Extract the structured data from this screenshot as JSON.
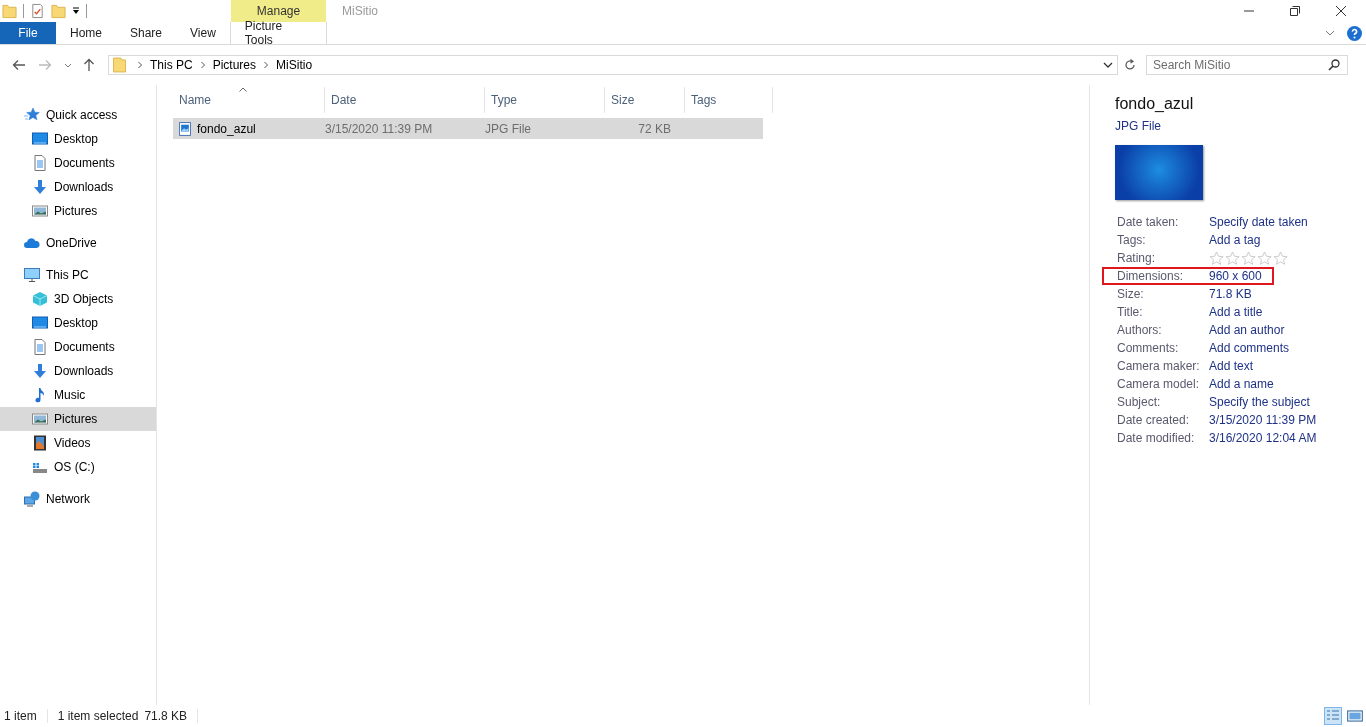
{
  "window": {
    "title": "MiSitio",
    "context_tab_group": "Manage"
  },
  "ribbon_tabs": [
    {
      "label": "File",
      "kind": "file",
      "selected": false
    },
    {
      "label": "Home",
      "kind": "tab",
      "selected": false
    },
    {
      "label": "Share",
      "kind": "tab",
      "selected": false
    },
    {
      "label": "View",
      "kind": "tab",
      "selected": false
    },
    {
      "label": "Picture Tools",
      "kind": "context",
      "selected": false
    }
  ],
  "breadcrumb": [
    "This PC",
    "Pictures",
    "MiSitio"
  ],
  "search": {
    "placeholder": "Search MiSitio"
  },
  "sidebar": {
    "items": [
      {
        "label": "Quick access",
        "kind": "star",
        "selected": false,
        "children": [
          {
            "label": "Desktop",
            "kind": "desktop",
            "selected": false
          },
          {
            "label": "Documents",
            "kind": "document",
            "selected": false
          },
          {
            "label": "Downloads",
            "kind": "download",
            "selected": false
          },
          {
            "label": "Pictures",
            "kind": "picture",
            "selected": false
          }
        ]
      },
      {
        "label": "OneDrive",
        "kind": "cloud",
        "selected": false
      },
      {
        "label": "This PC",
        "kind": "pc",
        "selected": false,
        "children": [
          {
            "label": "3D Objects",
            "kind": "cube",
            "selected": false
          },
          {
            "label": "Desktop",
            "kind": "desktop",
            "selected": false
          },
          {
            "label": "Documents",
            "kind": "document",
            "selected": false
          },
          {
            "label": "Downloads",
            "kind": "download",
            "selected": false
          },
          {
            "label": "Music",
            "kind": "music",
            "selected": false
          },
          {
            "label": "Pictures",
            "kind": "picture",
            "selected": true
          },
          {
            "label": "Videos",
            "kind": "video",
            "selected": false
          },
          {
            "label": "OS (C:)",
            "kind": "drive",
            "selected": false
          }
        ]
      },
      {
        "label": "Network",
        "kind": "network",
        "selected": false
      }
    ]
  },
  "table": {
    "columns": [
      "Name",
      "Date",
      "Type",
      "Size",
      "Tags"
    ],
    "rows": [
      {
        "name": "fondo_azul",
        "date": "3/15/2020 11:39 PM",
        "type": "JPG File",
        "size": "72 KB",
        "selected": true
      }
    ]
  },
  "details": {
    "name": "fondo_azul",
    "type": "JPG File",
    "properties": [
      {
        "label": "Date taken:",
        "value": "Specify date taken",
        "kind": "text",
        "highlighted": false
      },
      {
        "label": "Tags:",
        "value": "Add a tag",
        "kind": "text",
        "highlighted": false
      },
      {
        "label": "Rating:",
        "kind": "rating",
        "stars": 0,
        "highlighted": false
      },
      {
        "label": "Dimensions:",
        "value": "960 x 600",
        "kind": "text",
        "highlighted": true
      },
      {
        "label": "Size:",
        "value": "71.8 KB",
        "kind": "text",
        "highlighted": false
      },
      {
        "label": "Title:",
        "value": "Add a title",
        "kind": "text",
        "highlighted": false
      },
      {
        "label": "Authors:",
        "value": "Add an author",
        "kind": "text",
        "highlighted": false
      },
      {
        "label": "Comments:",
        "value": "Add comments",
        "kind": "text",
        "highlighted": false
      },
      {
        "label": "Camera maker:",
        "value": "Add text",
        "kind": "text",
        "highlighted": false
      },
      {
        "label": "Camera model:",
        "value": "Add a name",
        "kind": "text",
        "highlighted": false
      },
      {
        "label": "Subject:",
        "value": "Specify the subject",
        "kind": "text",
        "highlighted": false
      },
      {
        "label": "Date created:",
        "value": "3/15/2020 11:39 PM",
        "kind": "text",
        "highlighted": false
      },
      {
        "label": "Date modified:",
        "value": "3/16/2020 12:04 AM",
        "kind": "text",
        "highlighted": false
      }
    ]
  },
  "status_bar": {
    "count": "1 item",
    "selection": "1 item selected",
    "size": "71.8 KB"
  }
}
